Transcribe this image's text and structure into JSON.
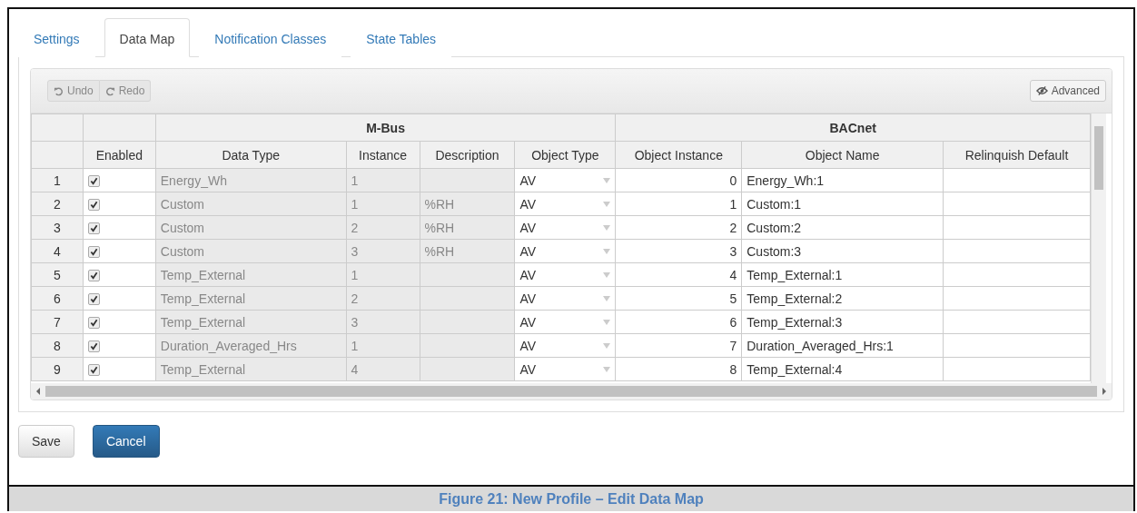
{
  "tabs": [
    {
      "label": "Settings",
      "selected": false
    },
    {
      "label": "Data Map",
      "selected": true
    },
    {
      "label": "Notification Classes",
      "selected": false
    },
    {
      "label": "State Tables",
      "selected": false
    }
  ],
  "toolbar": {
    "undo": "Undo",
    "redo": "Redo",
    "advanced": "Advanced"
  },
  "table": {
    "groups": [
      {
        "label": "M-Bus"
      },
      {
        "label": "BACnet"
      }
    ],
    "columns": [
      "Enabled",
      "Data Type",
      "Instance",
      "Description",
      "Object Type",
      "Object Instance",
      "Object Name",
      "Relinquish Default"
    ],
    "rows": [
      {
        "num": "1",
        "enabled": true,
        "data_type": "Energy_Wh",
        "instance": "1",
        "description": "",
        "object_type": "AV",
        "object_instance": "0",
        "object_name": "Energy_Wh:1"
      },
      {
        "num": "2",
        "enabled": true,
        "data_type": "Custom",
        "instance": "1",
        "description": "%RH",
        "object_type": "AV",
        "object_instance": "1",
        "object_name": "Custom:1"
      },
      {
        "num": "3",
        "enabled": true,
        "data_type": "Custom",
        "instance": "2",
        "description": "%RH",
        "object_type": "AV",
        "object_instance": "2",
        "object_name": "Custom:2"
      },
      {
        "num": "4",
        "enabled": true,
        "data_type": "Custom",
        "instance": "3",
        "description": "%RH",
        "object_type": "AV",
        "object_instance": "3",
        "object_name": "Custom:3"
      },
      {
        "num": "5",
        "enabled": true,
        "data_type": "Temp_External",
        "instance": "1",
        "description": "",
        "object_type": "AV",
        "object_instance": "4",
        "object_name": "Temp_External:1"
      },
      {
        "num": "6",
        "enabled": true,
        "data_type": "Temp_External",
        "instance": "2",
        "description": "",
        "object_type": "AV",
        "object_instance": "5",
        "object_name": "Temp_External:2"
      },
      {
        "num": "7",
        "enabled": true,
        "data_type": "Temp_External",
        "instance": "3",
        "description": "",
        "object_type": "AV",
        "object_instance": "6",
        "object_name": "Temp_External:3"
      },
      {
        "num": "8",
        "enabled": true,
        "data_type": "Duration_Averaged_Hrs",
        "instance": "1",
        "description": "",
        "object_type": "AV",
        "object_instance": "7",
        "object_name": "Duration_Averaged_Hrs:1"
      },
      {
        "num": "9",
        "enabled": true,
        "data_type": "Temp_External",
        "instance": "4",
        "description": "",
        "object_type": "AV",
        "object_instance": "8",
        "object_name": "Temp_External:4"
      }
    ]
  },
  "buttons": [
    {
      "label": "Save",
      "kind": "default"
    },
    {
      "label": "Cancel",
      "kind": "primary"
    }
  ],
  "caption": "Figure 21: New Profile – Edit Data Map"
}
